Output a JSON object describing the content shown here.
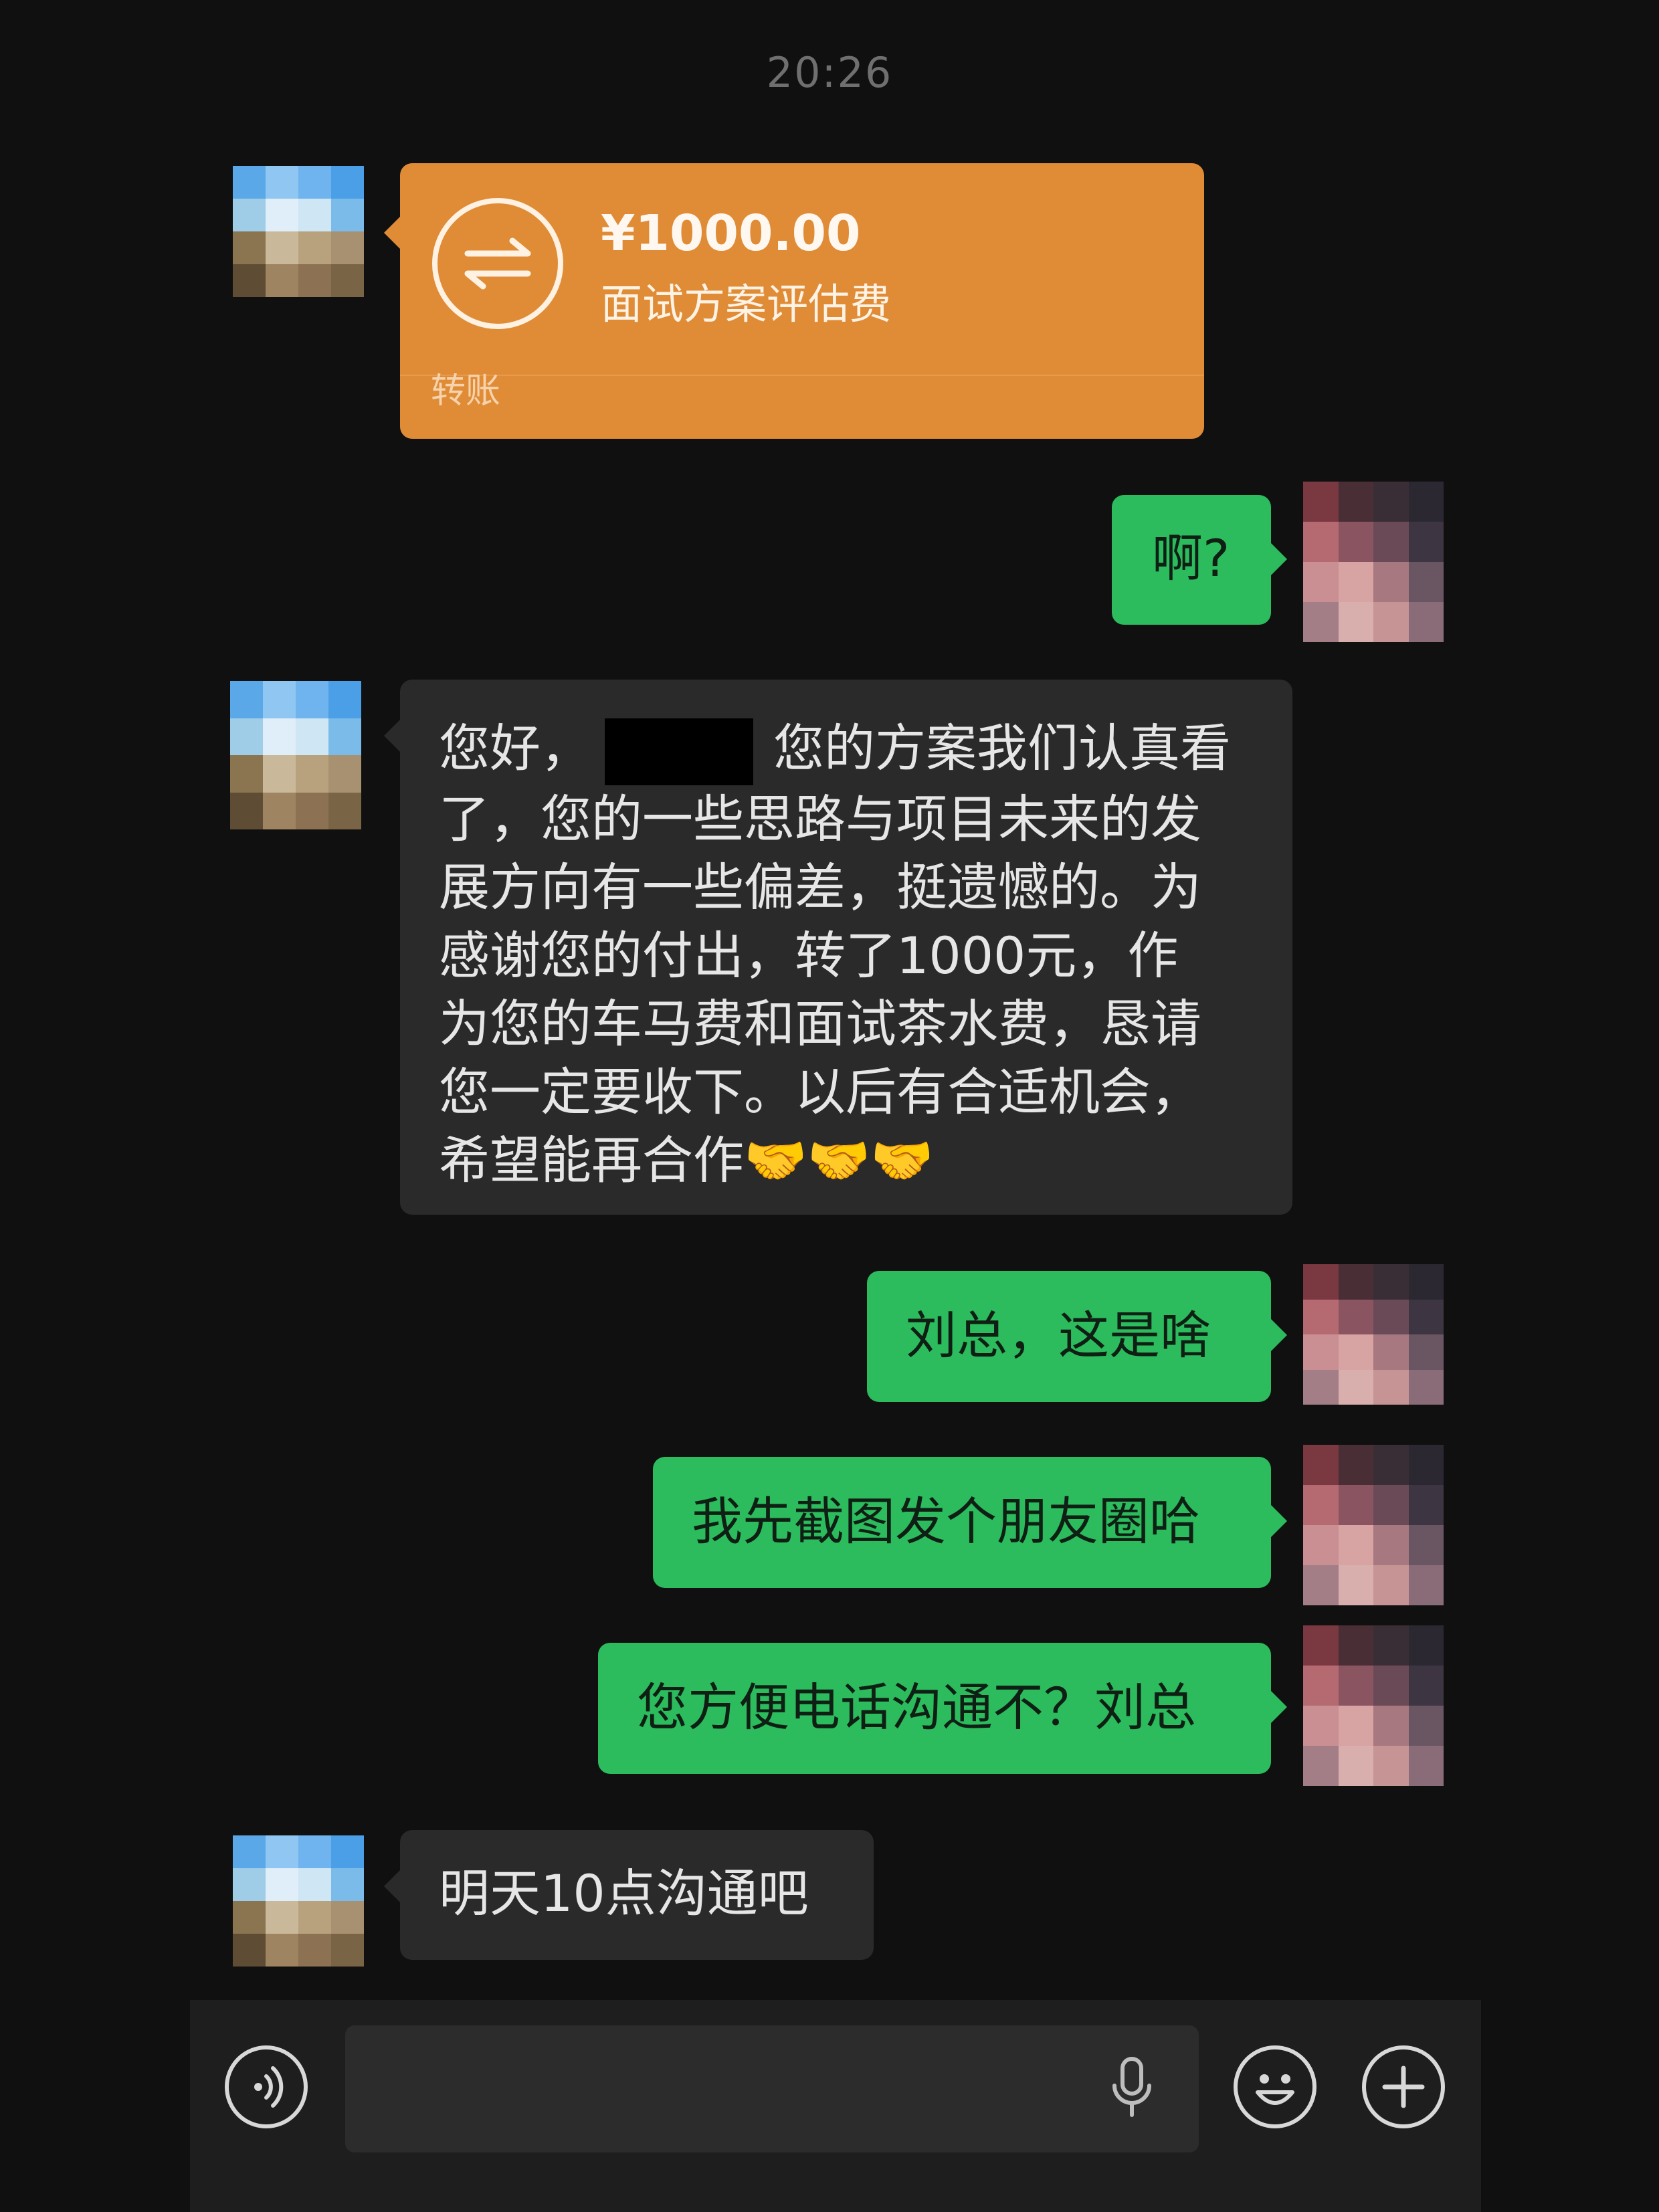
{
  "chat": {
    "timestamp": "20:26",
    "transfer": {
      "amount": "¥1000.00",
      "memo": "面试方案评估费",
      "type_label": "转账"
    },
    "messages": [
      {
        "from": "me",
        "text": "啊?"
      },
      {
        "from": "other",
        "lines": [
          "您好，",
          "您的方案我们认真看",
          "了，您的一些思路与项目未来的发",
          "展方向有一些偏差，挺遗憾的。为",
          "感谢您的付出，转了1000元，作",
          "为您的车马费和面试茶水费，恳请",
          "您一定要收下。以后有合适机会，",
          "希望能再合作🤝🤝🤝"
        ]
      },
      {
        "from": "me",
        "text": "刘总，这是啥"
      },
      {
        "from": "me",
        "text": "我先截图发个朋友圈哈"
      },
      {
        "from": "me",
        "text": "您方便电话沟通不？刘总"
      },
      {
        "from": "other",
        "text": "明天10点沟通吧"
      }
    ]
  },
  "input_bar": {
    "voice_icon": "voice-toggle-icon",
    "mic_icon": "microphone-icon",
    "emoji_icon": "emoji-icon",
    "plus_icon": "plus-icon"
  },
  "colors": {
    "background": "#101010",
    "incoming_bubble": "#2a2a2a",
    "outgoing_bubble": "#2cbb5d",
    "transfer_card": "#e08c37"
  }
}
